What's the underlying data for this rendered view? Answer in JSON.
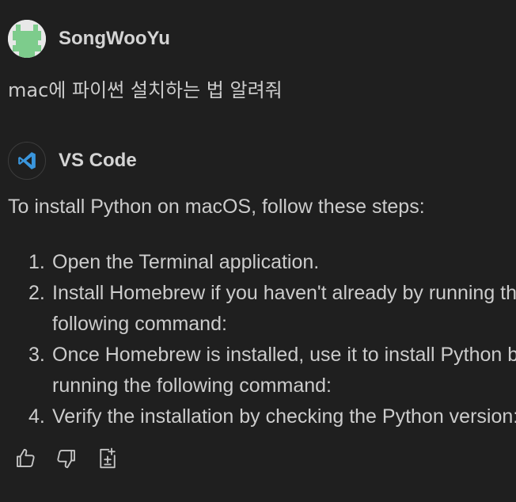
{
  "user_message": {
    "author": "SongWooYu",
    "avatar_icon": "pixel-avatar",
    "text": "mac에 파이썬 설치하는 법 알려줘"
  },
  "bot_message": {
    "author": "VS Code",
    "avatar_icon": "vscode-logo",
    "intro": "To install Python on macOS, follow these steps:",
    "steps": [
      {
        "num": "1.",
        "lines": [
          "Open the Terminal application."
        ]
      },
      {
        "num": "2.",
        "lines": [
          "Install Homebrew if you haven't already by running the",
          "following command:"
        ]
      },
      {
        "num": "3.",
        "lines": [
          "Once Homebrew is installed, use it to install Python by",
          "running the following command:"
        ]
      },
      {
        "num": "4.",
        "lines": [
          "Verify the installation by checking the Python version:"
        ]
      }
    ]
  },
  "actions": [
    {
      "name": "thumbs-up-icon"
    },
    {
      "name": "thumbs-down-icon"
    },
    {
      "name": "insert-into-new-file-icon"
    }
  ],
  "colors": {
    "background": "#1f1f1f",
    "text": "#cccccc",
    "vscode_blue": "#3a96dd",
    "avatar_green": "#7dcc8c"
  }
}
